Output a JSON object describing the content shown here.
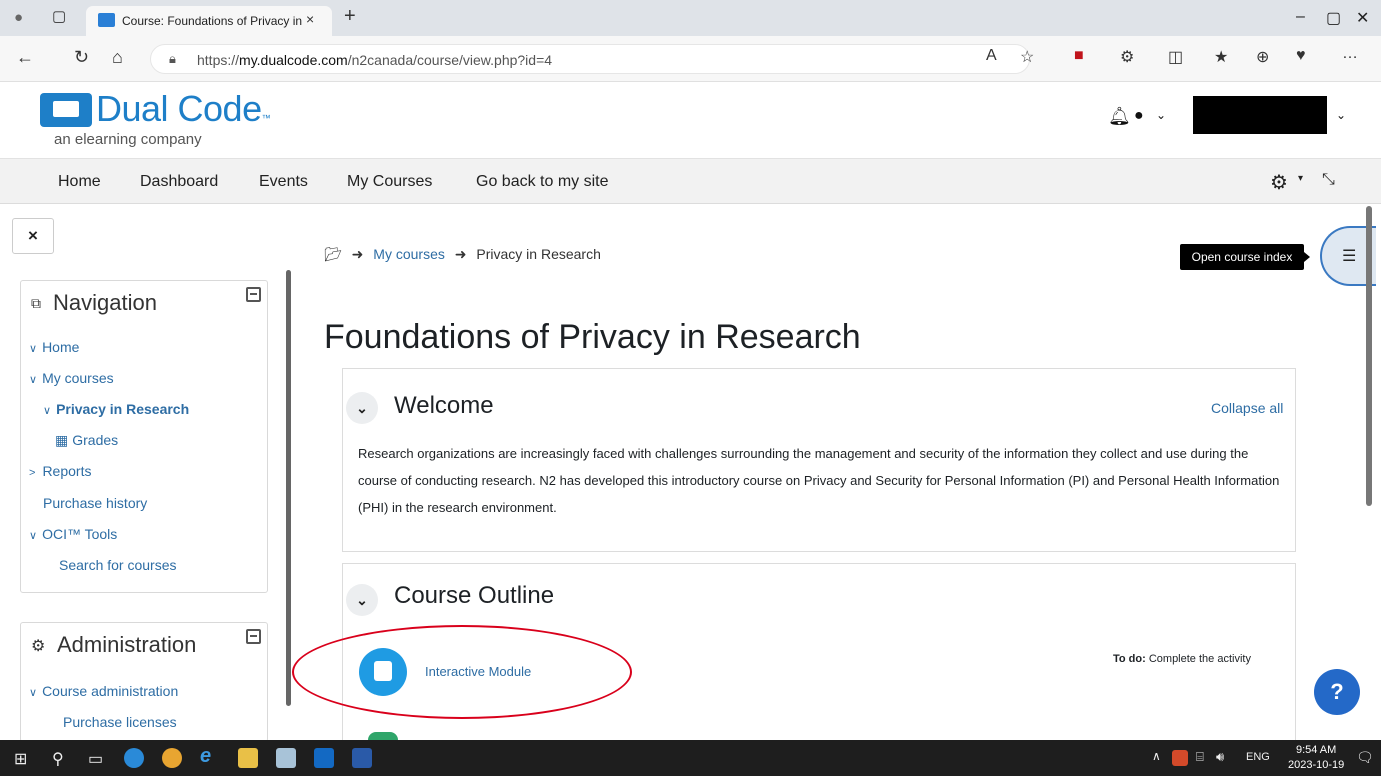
{
  "browser": {
    "tab_title": "Course: Foundations of Privacy in Research",
    "tab_close": "×",
    "new_tab": "+",
    "url_prefix": "https://",
    "url_domain": "my.dualcode.com",
    "url_path": "/n2canada/course/view.php?id=4",
    "window_controls": [
      "–",
      "▢",
      "✕"
    ]
  },
  "site": {
    "logo_text": "Dual Code",
    "logo_trademark": "™",
    "logo_tagline": "an elearning company"
  },
  "navbar": {
    "items": [
      "Home",
      "Dashboard",
      "Events",
      "My Courses",
      "Go back to my site"
    ]
  },
  "drawer": {
    "close_label": "×",
    "navigation": {
      "title": "Navigation",
      "items": [
        {
          "label": "Home",
          "prefix": "∨"
        },
        {
          "label": "My courses",
          "prefix": "∨"
        },
        {
          "label": "Privacy in Research",
          "prefix": "∨"
        },
        {
          "label": "Grades",
          "prefix": "▦"
        },
        {
          "label": "Reports",
          "prefix": ">"
        },
        {
          "label": "Purchase history",
          "prefix": ""
        },
        {
          "label": "OCI™ Tools",
          "prefix": "∨"
        },
        {
          "label": "Search for courses",
          "prefix": ""
        }
      ]
    },
    "administration": {
      "title": "Administration",
      "items": [
        {
          "label": "Course administration",
          "prefix": "∨"
        },
        {
          "label": "Purchase licenses",
          "prefix": ""
        }
      ]
    }
  },
  "breadcrumb": {
    "items": [
      "My courses",
      "Privacy in Research"
    ]
  },
  "course_index_tooltip": "Open course index",
  "page_title": "Foundations of Privacy in Research",
  "sections": {
    "welcome": {
      "title": "Welcome",
      "collapse_all": "Collapse all",
      "summary": "Research organizations are increasingly faced with challenges surrounding the management and security of the information they collect and use during the course of conducting research. N2 has developed this introductory course on Privacy and Security for Personal Information (PI) and Personal Health Information (PHI) in the research environment."
    },
    "outline": {
      "title": "Course Outline",
      "activity_name": "Interactive Module",
      "todo_label": "To do:",
      "todo_text": "Complete the activity"
    }
  },
  "help_label": "?",
  "taskbar": {
    "time": "9:54 AM",
    "date": "2023-10-19",
    "language": "ENG"
  }
}
